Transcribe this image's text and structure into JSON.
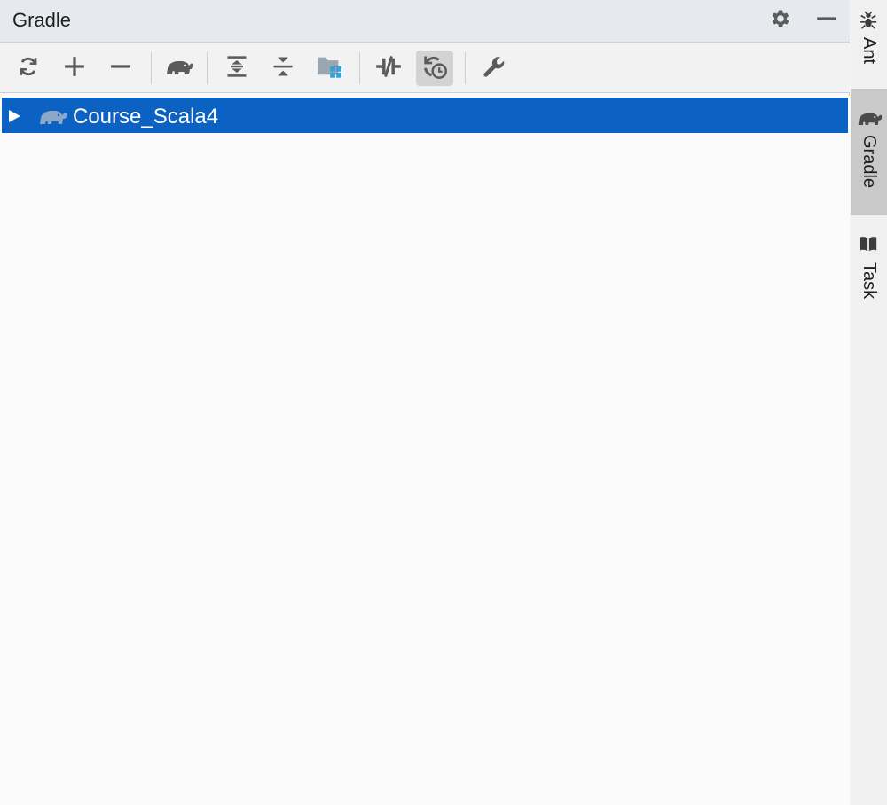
{
  "window": {
    "title": "Gradle"
  },
  "title_actions": [
    {
      "name": "settings",
      "icon": "gear-icon"
    },
    {
      "name": "minimize",
      "icon": "minus-icon"
    }
  ],
  "toolbar": [
    {
      "name": "reload",
      "icon": "refresh-icon"
    },
    {
      "name": "link",
      "icon": "plus-icon"
    },
    {
      "name": "unlink",
      "icon": "minus-icon"
    },
    {
      "name": "execute-task",
      "icon": "elephant-icon"
    },
    {
      "name": "expand-all",
      "icon": "expand-all-icon"
    },
    {
      "name": "collapse-all",
      "icon": "collapse-all-icon"
    },
    {
      "name": "project-structure",
      "icon": "folder-modules-icon"
    },
    {
      "name": "toggle-offline",
      "icon": "offline-icon"
    },
    {
      "name": "auto-reload",
      "icon": "refresh-clock-icon",
      "active": true
    },
    {
      "name": "build-tool-settings",
      "icon": "wrench-icon"
    }
  ],
  "tree": {
    "items": [
      {
        "label": "Course_Scala4",
        "expanded": false,
        "selected": true,
        "icon": "elephant-icon"
      }
    ]
  },
  "side_tabs": [
    {
      "label": "Ant",
      "icon": "ant-icon",
      "active": false
    },
    {
      "label": "Gradle",
      "icon": "elephant-icon",
      "active": true
    },
    {
      "label": "Task",
      "icon": "book-icon",
      "active": false
    }
  ],
  "colors": {
    "selection": "#0b62c2",
    "icon": "#5b5b5b",
    "accent_blue": "#389fd6"
  }
}
